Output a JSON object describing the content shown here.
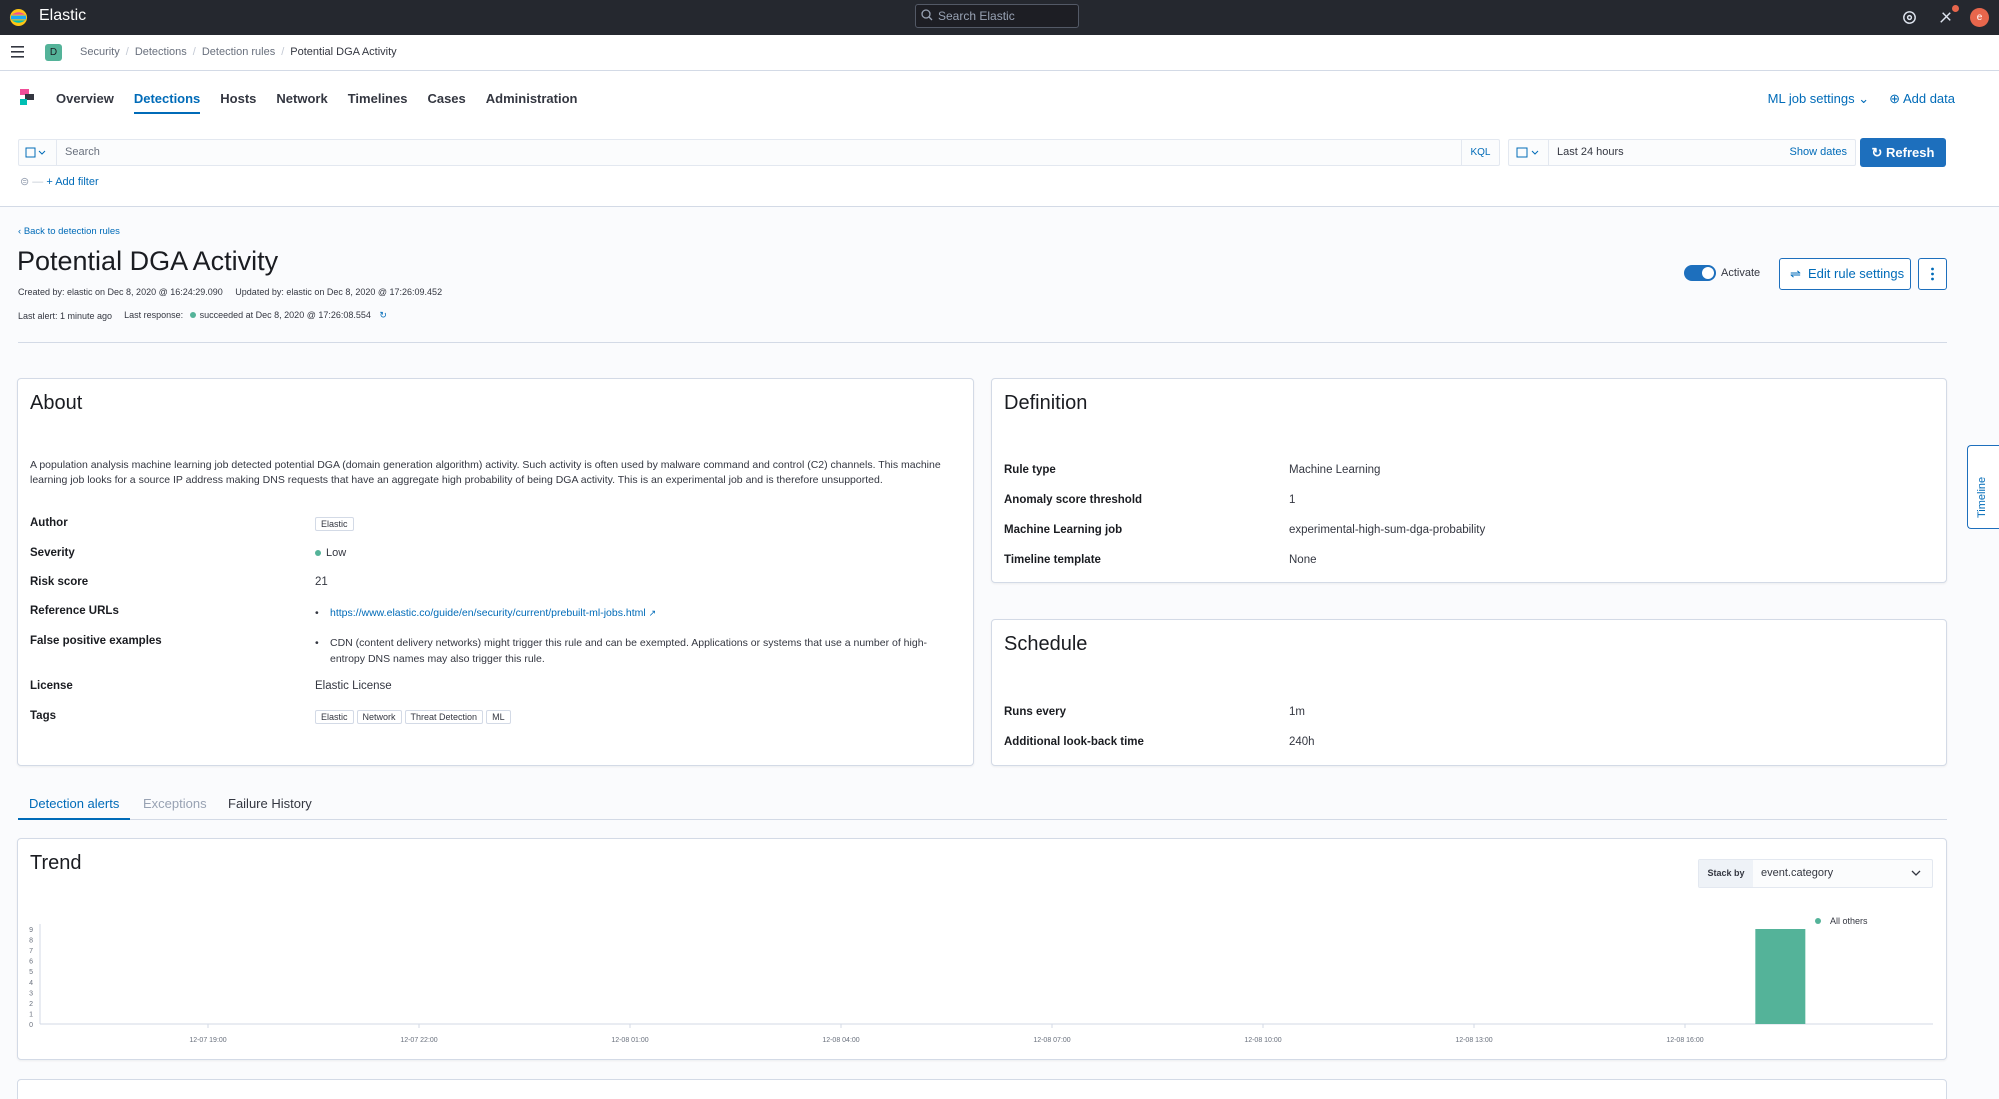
{
  "header": {
    "brand": "Elastic",
    "search_placeholder": "Search Elastic",
    "avatar_initial": "e"
  },
  "breadcrumbs": {
    "space": "D",
    "items": [
      "Security",
      "Detections",
      "Detection rules",
      "Potential DGA Activity"
    ]
  },
  "nav": {
    "tabs": [
      "Overview",
      "Detections",
      "Hosts",
      "Network",
      "Timelines",
      "Cases",
      "Administration"
    ],
    "active_tab": "Detections",
    "ml_settings": "ML job settings",
    "add_data": "Add data"
  },
  "query": {
    "placeholder": "Search",
    "language": "KQL",
    "time_range": "Last 24 hours",
    "show_dates": "Show dates",
    "refresh": "Refresh",
    "add_filter": "+ Add filter"
  },
  "rule": {
    "back_link": "Back to detection rules",
    "title": "Potential DGA Activity",
    "created": "Created by: elastic on Dec 8, 2020 @ 16:24:29.090",
    "updated": "Updated by: elastic on Dec 8, 2020 @ 17:26:09.452",
    "last_alert": "Last alert: 1 minute ago",
    "last_response_label": "Last response:",
    "last_response": "succeeded at Dec 8, 2020 @ 17:26:08.554",
    "activate": "Activate",
    "edit": "Edit rule settings"
  },
  "about": {
    "title": "About",
    "description": "A population analysis machine learning job detected potential DGA (domain generation algorithm) activity. Such activity is often used by malware command and control (C2) channels. This machine learning job looks for a source IP address making DNS requests that have an aggregate high probability of being DGA activity. This is an experimental job and is therefore unsupported.",
    "author_label": "Author",
    "author": "Elastic",
    "severity_label": "Severity",
    "severity": "Low",
    "risk_label": "Risk score",
    "risk": "21",
    "ref_label": "Reference URLs",
    "ref_url": "https://www.elastic.co/guide/en/security/current/prebuilt-ml-jobs.html",
    "fp_label": "False positive examples",
    "fp": "CDN (content delivery networks) might trigger this rule and can be exempted. Applications or systems that use a number of high-entropy DNS names may also trigger this rule.",
    "license_label": "License",
    "license": "Elastic License",
    "tags_label": "Tags",
    "tags": [
      "Elastic",
      "Network",
      "Threat Detection",
      "ML"
    ]
  },
  "definition": {
    "title": "Definition",
    "rows": [
      {
        "k": "Rule type",
        "v": "Machine Learning"
      },
      {
        "k": "Anomaly score threshold",
        "v": "1"
      },
      {
        "k": "Machine Learning job",
        "v": "experimental-high-sum-dga-probability"
      },
      {
        "k": "Timeline template",
        "v": "None"
      }
    ]
  },
  "schedule": {
    "title": "Schedule",
    "rows": [
      {
        "k": "Runs every",
        "v": "1m"
      },
      {
        "k": "Additional look-back time",
        "v": "240h"
      }
    ]
  },
  "bottom_tabs": [
    "Detection alerts",
    "Exceptions",
    "Failure History"
  ],
  "trend": {
    "title": "Trend",
    "stack_by_label": "Stack by",
    "stack_by_value": "event.category"
  },
  "timeline_tab": "Timeline",
  "colors": {
    "accent": "#006bb8",
    "bar": "#54b399",
    "header_bg": "#25282f"
  },
  "chart_data": {
    "type": "bar",
    "y_ticks": [
      "0",
      "1",
      "2",
      "3",
      "4",
      "5",
      "6",
      "7",
      "8",
      "9"
    ],
    "x_ticks": [
      "12-07 19:00",
      "12-07 22:00",
      "12-08 01:00",
      "12-08 04:00",
      "12-08 07:00",
      "12-08 10:00",
      "12-08 13:00",
      "12-08 16:00"
    ],
    "ylim": [
      0,
      9
    ],
    "series": [
      {
        "name": "All others",
        "values": [
          9
        ]
      }
    ],
    "bar_time": "12-08 17:00",
    "legend": "All others"
  }
}
